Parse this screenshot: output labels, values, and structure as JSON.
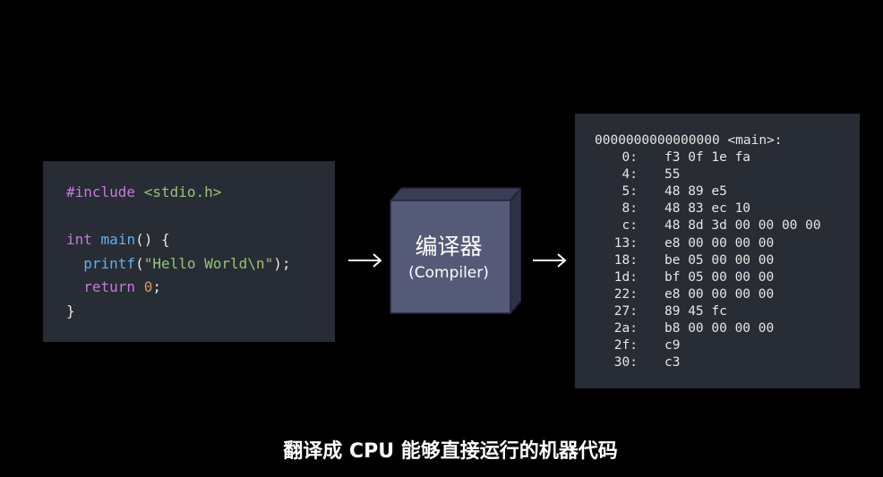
{
  "source_code": {
    "line1_directive": "#include",
    "line1_header": "<stdio.h>",
    "line3_type": "int",
    "line3_func": "main",
    "line3_rest": "() {",
    "line4_func": "printf",
    "line4_open": "(",
    "line4_string": "\"Hello World\\n\"",
    "line4_close": ");",
    "line5_keyword": "return",
    "line5_value": "0",
    "line5_semi": ";",
    "line6": "}"
  },
  "compiler": {
    "title": "编译器",
    "subtitle": "(Compiler)"
  },
  "machine_code": {
    "header": "0000000000000000 <main>:",
    "rows": [
      {
        "addr": "0:",
        "bytes": "f3 0f 1e fa"
      },
      {
        "addr": "4:",
        "bytes": "55"
      },
      {
        "addr": "5:",
        "bytes": "48 89 e5"
      },
      {
        "addr": "8:",
        "bytes": "48 83 ec 10"
      },
      {
        "addr": "c:",
        "bytes": "48 8d 3d 00 00 00 00"
      },
      {
        "addr": "13:",
        "bytes": "e8 00 00 00 00"
      },
      {
        "addr": "18:",
        "bytes": "be 05 00 00 00"
      },
      {
        "addr": "1d:",
        "bytes": "bf 05 00 00 00"
      },
      {
        "addr": "22:",
        "bytes": "e8 00 00 00 00"
      },
      {
        "addr": "27:",
        "bytes": "89 45 fc"
      },
      {
        "addr": "2a:",
        "bytes": "b8 00 00 00 00"
      },
      {
        "addr": "2f:",
        "bytes": "c9"
      },
      {
        "addr": "30:",
        "bytes": "c3"
      }
    ]
  },
  "subtitle": "翻译成 CPU 能够直接运行的机器代码",
  "colors": {
    "background": "#000000",
    "panel": "#282c34",
    "cube_front": "#555a78",
    "keyword": "#c678dd",
    "function": "#61afef",
    "string": "#98c379",
    "number": "#d19a66"
  }
}
